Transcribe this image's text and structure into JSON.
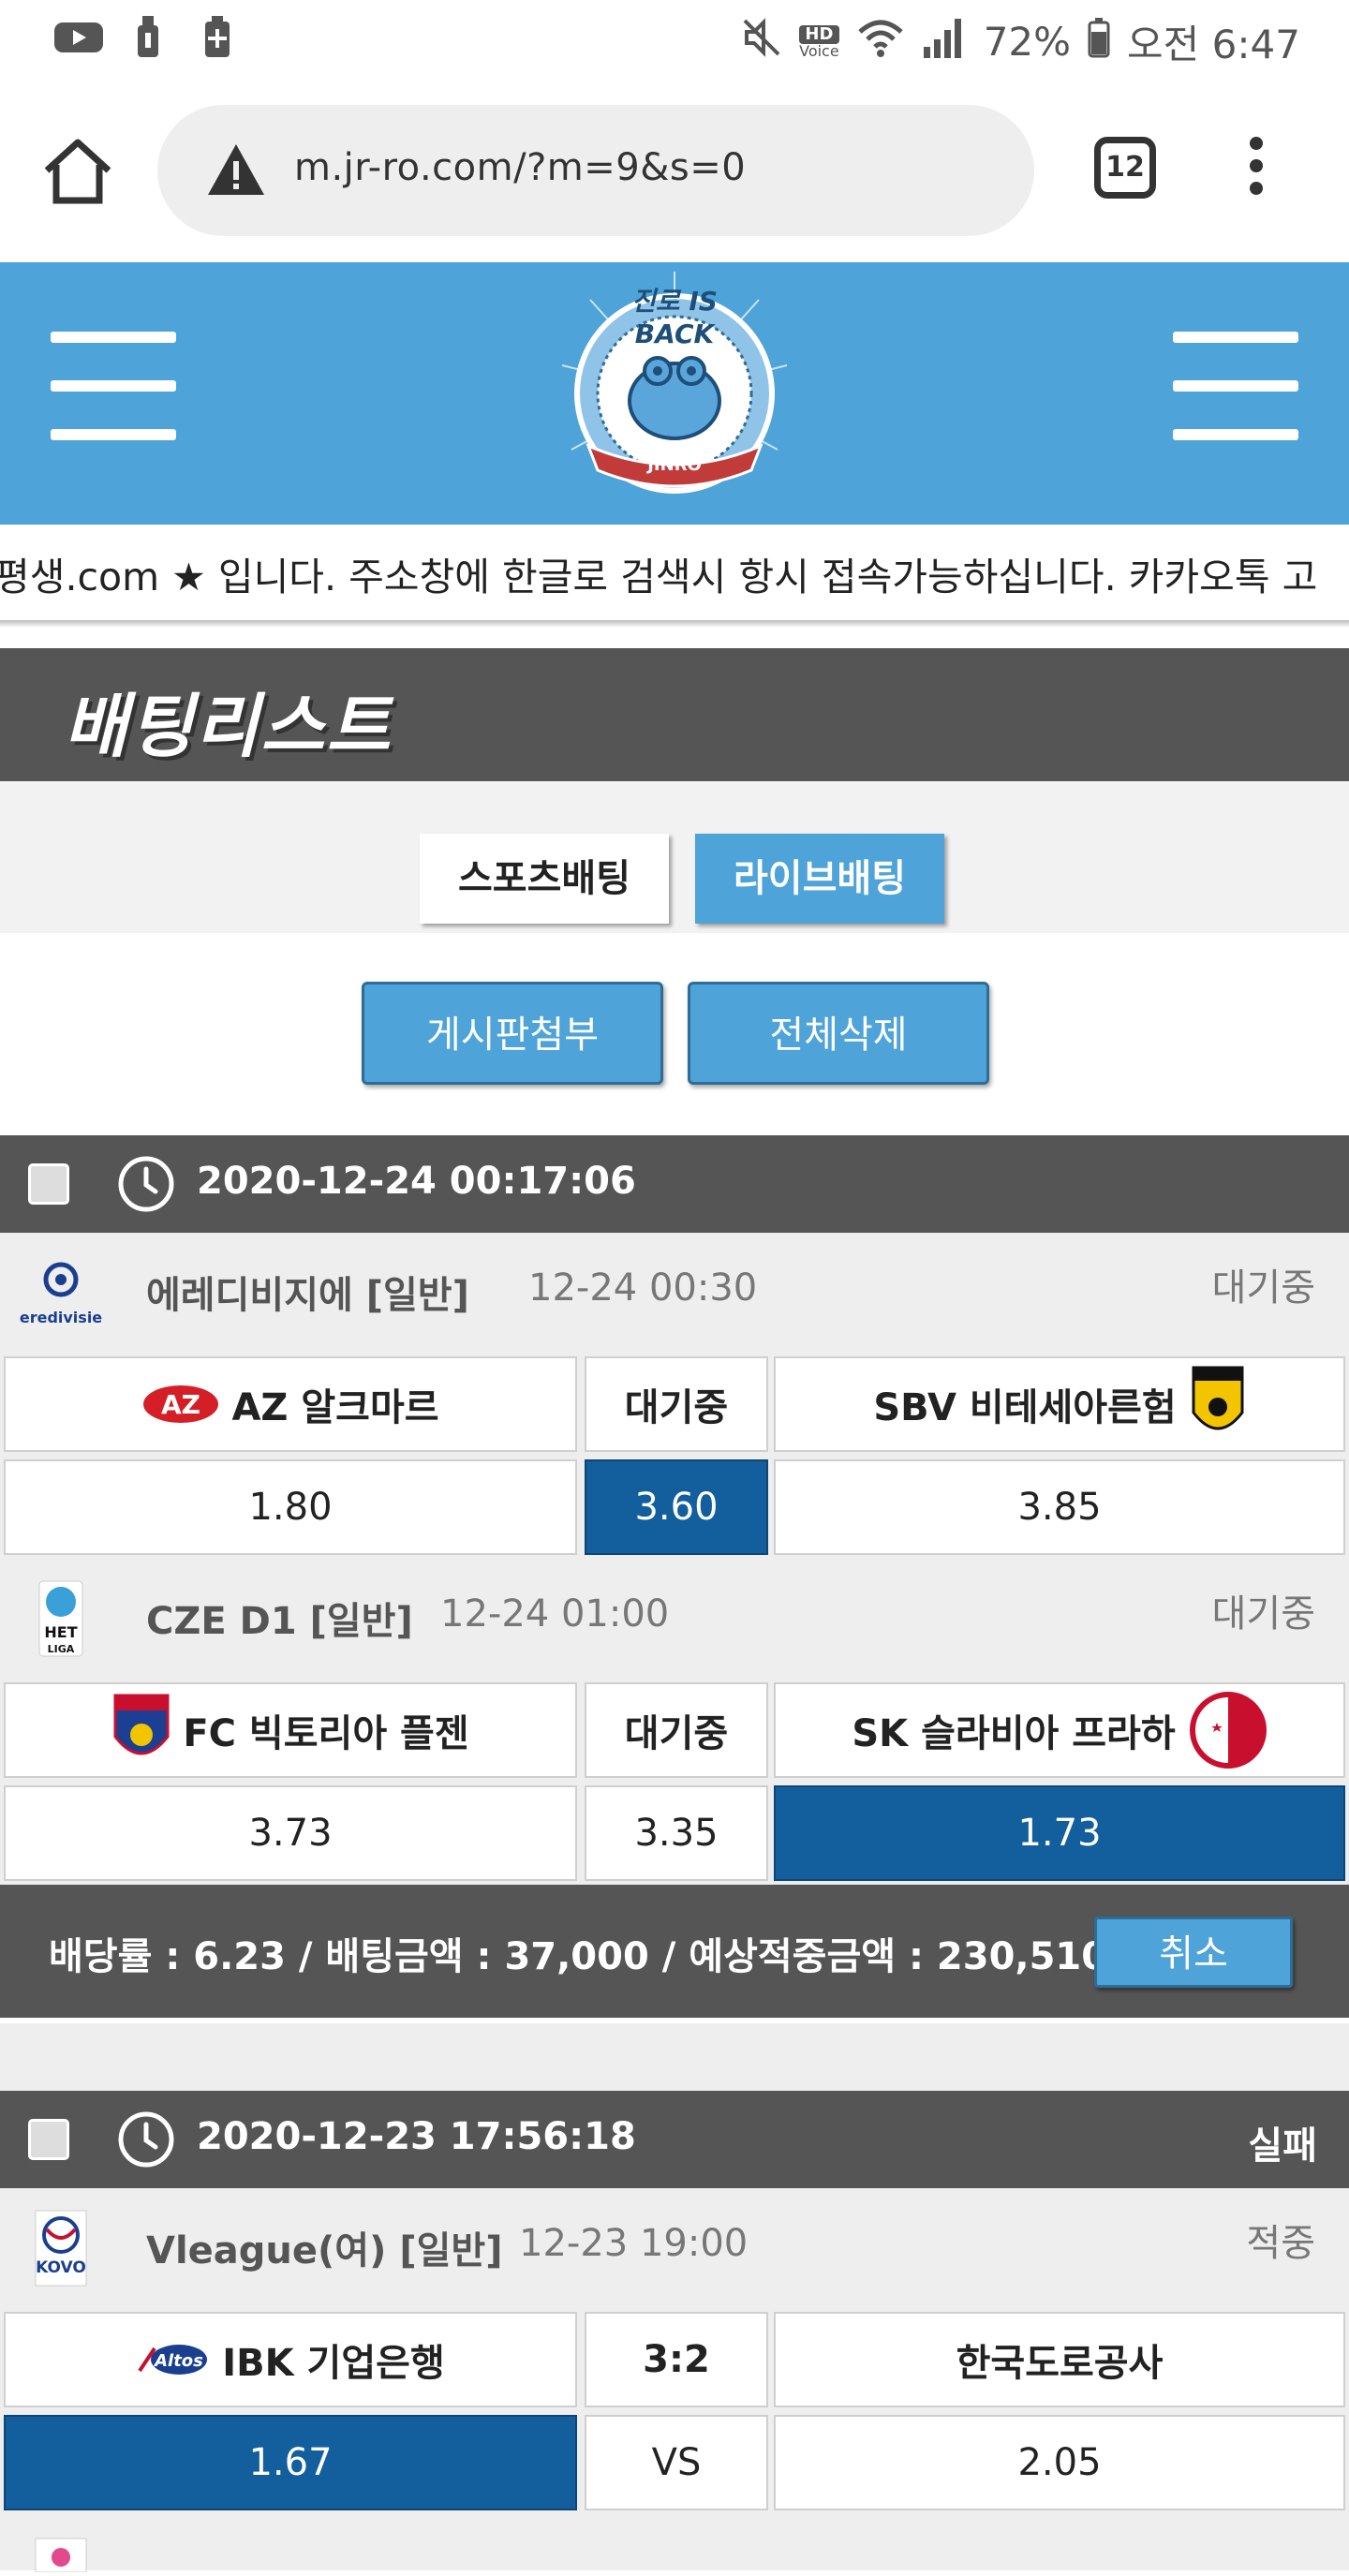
{
  "status_bar": {
    "battery": "72%",
    "time": "오전 6:47",
    "hd_label": "HD",
    "voice_label": "Voice"
  },
  "browser": {
    "url": "m.jr-ro.com/?m=9&s=0",
    "tab_count": "12"
  },
  "site": {
    "logo_top_text": "진로 IS BACK",
    "logo_ribbon_text": "JINRO",
    "marquee": "평생.com ★ 입니다. 주소창에 한글로 검색시 항시 접속가능하십니다. 카카오톡 고",
    "page_title": "배팅리스트",
    "tabs": [
      "스포츠배팅",
      "라이브배팅"
    ],
    "actions": [
      "게시판첨부",
      "전체삭제"
    ]
  },
  "colors": {
    "header_blue": "#4ea3d8",
    "selected_blue": "#135e9c",
    "dark_gray": "#555555"
  },
  "slips": [
    {
      "datetime": "2020-12-24 00:17:06",
      "result": "",
      "games": [
        {
          "league_icon": "eredivisie-logo",
          "league": "에레디비지에  [일반]",
          "kickoff": "12-24 00:30",
          "status": "대기중",
          "home": "AZ 알크마르",
          "middle": "대기중",
          "away": "SBV 비테세아른험",
          "odds": [
            "1.80",
            "3.60",
            "3.85"
          ],
          "selected": 1
        },
        {
          "league_icon": "het-liga-logo",
          "league": "CZE D1  [일반]",
          "kickoff": "12-24 01:00",
          "status": "대기중",
          "home": "FC 빅토리아 플젠",
          "middle": "대기중",
          "away": "SK 슬라비아 프라하",
          "odds": [
            "3.73",
            "3.35",
            "1.73"
          ],
          "selected": 2
        }
      ],
      "summary": "배당률 : 6.23 / 배팅금액 : 37,000 / 예상적중금액 : 230,510",
      "cancel_label": "취소"
    },
    {
      "datetime": "2020-12-23 17:56:18",
      "result": "실패",
      "games": [
        {
          "league_icon": "kovo-logo",
          "league": "Vleague(여)  [일반]",
          "kickoff": "12-23 19:00",
          "status": "적중",
          "home": "IBK 기업은행",
          "middle": "3:2",
          "away": "한국도로공사",
          "odds": [
            "1.67",
            "VS",
            "2.05"
          ],
          "selected": 0
        }
      ]
    }
  ]
}
